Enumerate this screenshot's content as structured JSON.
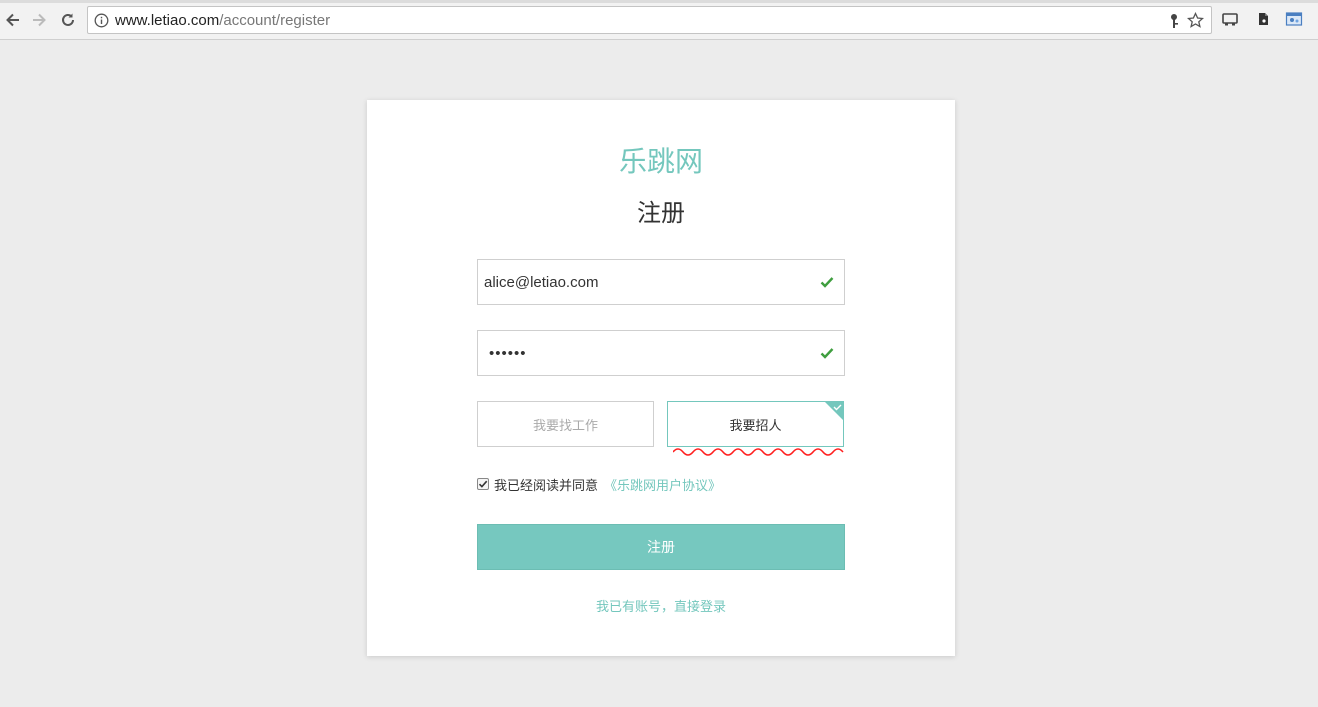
{
  "browser": {
    "url_host": "www.letiao.com",
    "url_path": "/account/register"
  },
  "page": {
    "brand": "乐跳网",
    "heading": "注册",
    "email_value": "alice@letiao.com",
    "password_value": "••••••",
    "role_seeker": "我要找工作",
    "role_recruiter": "我要招人",
    "agree_text": "我已经阅读并同意",
    "agreement_link": "《乐跳网用户协议》",
    "submit_label": "注册",
    "login_link": "我已有账号，直接登录"
  },
  "colors": {
    "accent": "#74c7bd",
    "check": "#3f9e3f",
    "squiggle": "#ff2020"
  }
}
